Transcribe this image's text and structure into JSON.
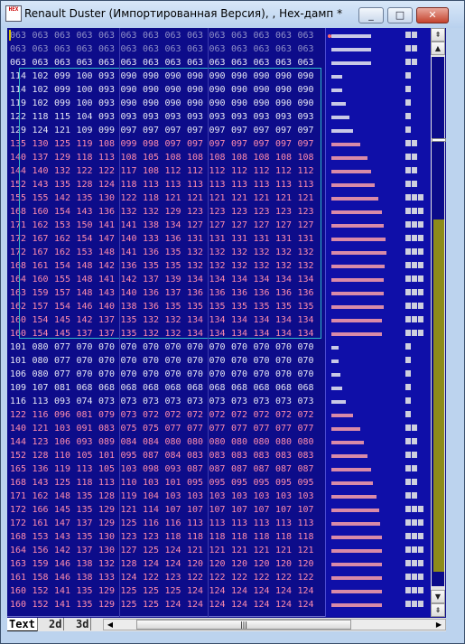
{
  "window": {
    "title": "Renault Duster (Импортированная Версия), , Hex-дамп *",
    "icon_label": "HEX",
    "buttons": {
      "minimize": "_",
      "maximize": "□",
      "close": "✕"
    }
  },
  "colors": {
    "row_white": "#e6e6f5",
    "row_pink": "#ff8cae",
    "row_gray": "#8f8fc8",
    "graph_bar": "#d98aa8",
    "background": "#0d0c8a"
  },
  "hex_rows": [
    {
      "c": "gray",
      "v": [
        "063",
        "063",
        "063",
        "063",
        "063",
        "063",
        "063",
        "063",
        "063",
        "063",
        "063",
        "063",
        "063",
        "063"
      ]
    },
    {
      "c": "gray",
      "v": [
        "063",
        "063",
        "063",
        "063",
        "063",
        "063",
        "063",
        "063",
        "063",
        "063",
        "063",
        "063",
        "063",
        "063"
      ]
    },
    {
      "c": "white",
      "v": [
        "063",
        "063",
        "063",
        "063",
        "063",
        "063",
        "063",
        "063",
        "063",
        "063",
        "063",
        "063",
        "063",
        "063"
      ]
    },
    {
      "c": "white",
      "v": [
        "114",
        "102",
        "099",
        "100",
        "093",
        "090",
        "090",
        "090",
        "090",
        "090",
        "090",
        "090",
        "090",
        "090"
      ]
    },
    {
      "c": "white",
      "v": [
        "114",
        "102",
        "099",
        "100",
        "093",
        "090",
        "090",
        "090",
        "090",
        "090",
        "090",
        "090",
        "090",
        "090"
      ]
    },
    {
      "c": "white",
      "v": [
        "119",
        "102",
        "099",
        "100",
        "093",
        "090",
        "090",
        "090",
        "090",
        "090",
        "090",
        "090",
        "090",
        "090"
      ]
    },
    {
      "c": "white",
      "v": [
        "122",
        "118",
        "115",
        "104",
        "093",
        "093",
        "093",
        "093",
        "093",
        "093",
        "093",
        "093",
        "093",
        "093"
      ]
    },
    {
      "c": "white",
      "v": [
        "129",
        "124",
        "121",
        "109",
        "099",
        "097",
        "097",
        "097",
        "097",
        "097",
        "097",
        "097",
        "097",
        "097"
      ]
    },
    {
      "c": "pink",
      "v": [
        "135",
        "130",
        "125",
        "119",
        "108",
        "099",
        "098",
        "097",
        "097",
        "097",
        "097",
        "097",
        "097",
        "097"
      ]
    },
    {
      "c": "pink",
      "v": [
        "140",
        "137",
        "129",
        "118",
        "113",
        "108",
        "105",
        "108",
        "108",
        "108",
        "108",
        "108",
        "108",
        "108"
      ]
    },
    {
      "c": "pink",
      "v": [
        "144",
        "140",
        "132",
        "122",
        "122",
        "117",
        "108",
        "112",
        "112",
        "112",
        "112",
        "112",
        "112",
        "112"
      ]
    },
    {
      "c": "pink",
      "v": [
        "152",
        "143",
        "135",
        "128",
        "124",
        "118",
        "113",
        "113",
        "113",
        "113",
        "113",
        "113",
        "113",
        "113"
      ]
    },
    {
      "c": "pink",
      "v": [
        "155",
        "155",
        "142",
        "135",
        "130",
        "122",
        "118",
        "121",
        "121",
        "121",
        "121",
        "121",
        "121",
        "121"
      ]
    },
    {
      "c": "pink",
      "v": [
        "168",
        "160",
        "154",
        "143",
        "136",
        "132",
        "132",
        "129",
        "123",
        "123",
        "123",
        "123",
        "123",
        "123"
      ]
    },
    {
      "c": "pink",
      "v": [
        "171",
        "162",
        "153",
        "150",
        "141",
        "141",
        "138",
        "134",
        "127",
        "127",
        "127",
        "127",
        "127",
        "127"
      ]
    },
    {
      "c": "pink",
      "v": [
        "172",
        "167",
        "162",
        "154",
        "147",
        "140",
        "133",
        "136",
        "131",
        "131",
        "131",
        "131",
        "131",
        "131"
      ]
    },
    {
      "c": "pink",
      "v": [
        "172",
        "167",
        "162",
        "153",
        "148",
        "141",
        "136",
        "135",
        "132",
        "132",
        "132",
        "132",
        "132",
        "132"
      ]
    },
    {
      "c": "pink",
      "v": [
        "168",
        "161",
        "154",
        "148",
        "142",
        "136",
        "135",
        "135",
        "132",
        "132",
        "132",
        "132",
        "132",
        "132"
      ]
    },
    {
      "c": "pink",
      "v": [
        "164",
        "160",
        "155",
        "148",
        "141",
        "142",
        "137",
        "139",
        "134",
        "134",
        "134",
        "134",
        "134",
        "134"
      ]
    },
    {
      "c": "pink",
      "v": [
        "163",
        "159",
        "157",
        "148",
        "143",
        "140",
        "136",
        "137",
        "136",
        "136",
        "136",
        "136",
        "136",
        "136"
      ]
    },
    {
      "c": "pink",
      "v": [
        "162",
        "157",
        "154",
        "146",
        "140",
        "138",
        "136",
        "135",
        "135",
        "135",
        "135",
        "135",
        "135",
        "135"
      ]
    },
    {
      "c": "pink",
      "v": [
        "160",
        "154",
        "145",
        "142",
        "137",
        "135",
        "132",
        "132",
        "134",
        "134",
        "134",
        "134",
        "134",
        "134"
      ]
    },
    {
      "c": "pink",
      "v": [
        "160",
        "154",
        "145",
        "137",
        "137",
        "135",
        "132",
        "132",
        "134",
        "134",
        "134",
        "134",
        "134",
        "134"
      ]
    },
    {
      "c": "white",
      "v": [
        "101",
        "080",
        "077",
        "070",
        "070",
        "070",
        "070",
        "070",
        "070",
        "070",
        "070",
        "070",
        "070",
        "070"
      ]
    },
    {
      "c": "white",
      "v": [
        "101",
        "080",
        "077",
        "070",
        "070",
        "070",
        "070",
        "070",
        "070",
        "070",
        "070",
        "070",
        "070",
        "070"
      ]
    },
    {
      "c": "white",
      "v": [
        "106",
        "080",
        "077",
        "070",
        "070",
        "070",
        "070",
        "070",
        "070",
        "070",
        "070",
        "070",
        "070",
        "070"
      ]
    },
    {
      "c": "white",
      "v": [
        "109",
        "107",
        "081",
        "068",
        "068",
        "068",
        "068",
        "068",
        "068",
        "068",
        "068",
        "068",
        "068",
        "068"
      ]
    },
    {
      "c": "white",
      "v": [
        "116",
        "113",
        "093",
        "074",
        "073",
        "073",
        "073",
        "073",
        "073",
        "073",
        "073",
        "073",
        "073",
        "073"
      ]
    },
    {
      "c": "pink",
      "v": [
        "122",
        "116",
        "096",
        "081",
        "079",
        "073",
        "072",
        "072",
        "072",
        "072",
        "072",
        "072",
        "072",
        "072"
      ]
    },
    {
      "c": "pink",
      "v": [
        "140",
        "121",
        "103",
        "091",
        "083",
        "075",
        "075",
        "077",
        "077",
        "077",
        "077",
        "077",
        "077",
        "077"
      ]
    },
    {
      "c": "pink",
      "v": [
        "144",
        "123",
        "106",
        "093",
        "089",
        "084",
        "084",
        "080",
        "080",
        "080",
        "080",
        "080",
        "080",
        "080"
      ]
    },
    {
      "c": "pink",
      "v": [
        "152",
        "128",
        "110",
        "105",
        "101",
        "095",
        "087",
        "084",
        "083",
        "083",
        "083",
        "083",
        "083",
        "083"
      ]
    },
    {
      "c": "pink",
      "v": [
        "165",
        "136",
        "119",
        "113",
        "105",
        "103",
        "098",
        "093",
        "087",
        "087",
        "087",
        "087",
        "087",
        "087"
      ]
    },
    {
      "c": "pink",
      "v": [
        "168",
        "143",
        "125",
        "118",
        "113",
        "110",
        "103",
        "101",
        "095",
        "095",
        "095",
        "095",
        "095",
        "095"
      ]
    },
    {
      "c": "pink",
      "v": [
        "171",
        "162",
        "148",
        "135",
        "128",
        "119",
        "104",
        "103",
        "103",
        "103",
        "103",
        "103",
        "103",
        "103"
      ]
    },
    {
      "c": "pink",
      "v": [
        "172",
        "166",
        "145",
        "135",
        "129",
        "121",
        "114",
        "107",
        "107",
        "107",
        "107",
        "107",
        "107",
        "107"
      ]
    },
    {
      "c": "pink",
      "v": [
        "172",
        "161",
        "147",
        "137",
        "129",
        "125",
        "116",
        "116",
        "113",
        "113",
        "113",
        "113",
        "113",
        "113"
      ]
    },
    {
      "c": "pink",
      "v": [
        "168",
        "153",
        "143",
        "135",
        "130",
        "123",
        "123",
        "118",
        "118",
        "118",
        "118",
        "118",
        "118",
        "118"
      ]
    },
    {
      "c": "pink",
      "v": [
        "164",
        "156",
        "142",
        "137",
        "130",
        "127",
        "125",
        "124",
        "121",
        "121",
        "121",
        "121",
        "121",
        "121"
      ]
    },
    {
      "c": "pink",
      "v": [
        "163",
        "159",
        "146",
        "138",
        "132",
        "128",
        "124",
        "124",
        "120",
        "120",
        "120",
        "120",
        "120",
        "120"
      ]
    },
    {
      "c": "pink",
      "v": [
        "161",
        "158",
        "146",
        "138",
        "133",
        "124",
        "122",
        "123",
        "122",
        "122",
        "122",
        "122",
        "122",
        "122"
      ]
    },
    {
      "c": "pink",
      "v": [
        "160",
        "152",
        "141",
        "135",
        "129",
        "125",
        "125",
        "125",
        "124",
        "124",
        "124",
        "124",
        "124",
        "124"
      ]
    },
    {
      "c": "pink",
      "v": [
        "160",
        "152",
        "141",
        "135",
        "129",
        "125",
        "125",
        "124",
        "124",
        "124",
        "124",
        "124",
        "124",
        "124"
      ]
    }
  ],
  "graph_levels": [
    0.55,
    0.55,
    0.55,
    0.15,
    0.15,
    0.2,
    0.25,
    0.3,
    0.4,
    0.5,
    0.55,
    0.6,
    0.65,
    0.7,
    0.72,
    0.75,
    0.76,
    0.74,
    0.72,
    0.72,
    0.72,
    0.7,
    0.7,
    0.1,
    0.1,
    0.12,
    0.15,
    0.2,
    0.3,
    0.4,
    0.45,
    0.5,
    0.55,
    0.58,
    0.62,
    0.66,
    0.68,
    0.7,
    0.7,
    0.7,
    0.7,
    0.7,
    0.7
  ],
  "tabs": [
    {
      "label": "Text"
    },
    {
      "label": "2d"
    },
    {
      "label": "3d"
    }
  ],
  "hscroll": {
    "left_arrow": "◀",
    "right_arrow": "▶",
    "grip": "|||"
  },
  "vscroll": {
    "top": "⇞",
    "up": "▲",
    "down": "▼",
    "bottom": "⇟"
  }
}
